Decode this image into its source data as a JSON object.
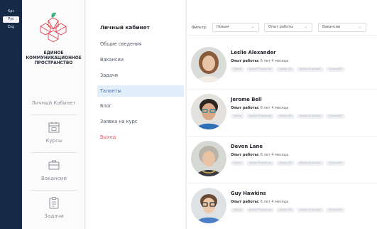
{
  "languages": [
    {
      "label": "Қаз",
      "active": false
    },
    {
      "label": "Рус",
      "active": true
    },
    {
      "label": "Eng",
      "active": false
    }
  ],
  "brand": {
    "line1": "ЕДИНОЕ",
    "line2": "КОММУНИКАЦИОННОЕ",
    "line3": "ПРОСТРАНСТВО"
  },
  "sidebar": {
    "cabinet_label": "Личный Кабинет",
    "items": [
      {
        "label": "Курсы",
        "icon": "calendar-icon"
      },
      {
        "label": "Вакансии",
        "icon": "briefcase-icon"
      },
      {
        "label": "Задачи",
        "icon": "clipboard-icon"
      }
    ]
  },
  "menu": {
    "title": "Личный кабинет",
    "items": [
      {
        "label": "Общие сведения",
        "active": false
      },
      {
        "label": "Вакансии",
        "active": false
      },
      {
        "label": "Задачи",
        "active": false
      },
      {
        "label": "Таланты",
        "active": true
      },
      {
        "label": "Блог",
        "active": false
      },
      {
        "label": "Заявка на курс",
        "active": false
      },
      {
        "label": "Выход",
        "active": false
      }
    ]
  },
  "filters": {
    "label": "Фильтр:",
    "selects": [
      {
        "value": "Новым"
      },
      {
        "value": "Опыт работы"
      },
      {
        "value": "Вакансии"
      }
    ]
  },
  "candidates": [
    {
      "name": "Leslie Alexander",
      "exp_label": "Опыт работы:",
      "exp_value": "6 лет 4 месяца",
      "tags": [
        "Figma",
        "Adobe Photoshop",
        "Adobe XD",
        "Adobe Illustrator",
        "Cinema4D"
      ]
    },
    {
      "name": "Jerome Bell",
      "exp_label": "Опыт работы:",
      "exp_value": "6 лет 4 месяца",
      "tags": [
        "Figma",
        "Adobe Photoshop",
        "Adobe XD",
        "Adobe Illustrator",
        "Cinema4D"
      ]
    },
    {
      "name": "Devon Lane",
      "exp_label": "Опыт работы:",
      "exp_value": "6 лет 4 месяца",
      "tags": [
        "Figma",
        "Adobe Photoshop",
        "Adobe XD",
        "Adobe Illustrator",
        "Cinema4D"
      ]
    },
    {
      "name": "Guy Hawkins",
      "exp_label": "Опыт работы:",
      "exp_value": "6 лет 4 месяца",
      "tags": [
        "Figma",
        "Adobe Photoshop",
        "Adobe XD",
        "Adobe Illustrator",
        "Cinema4D"
      ]
    }
  ],
  "colors": {
    "rail": "#172a45",
    "active_menu_bg": "#e3eefb",
    "logout": "#e05a64",
    "logo_red": "#e23b4a",
    "logo_green": "#3fb37a"
  }
}
